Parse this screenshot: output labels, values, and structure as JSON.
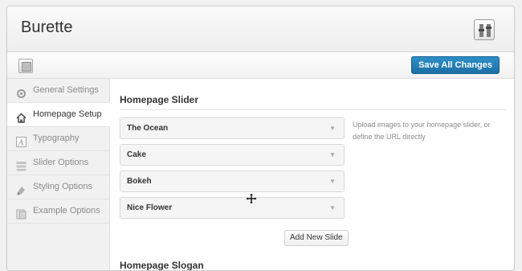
{
  "app": {
    "brand": "Burette",
    "header_icon": "tools-icon"
  },
  "toolbar": {
    "left_icon": "panel-icon",
    "save_label": "Save All Changes",
    "save_color": "#2277b5"
  },
  "sidebar": {
    "items": [
      {
        "label": "General Settings",
        "icon": "gear-icon",
        "active": false
      },
      {
        "label": "Homepage Setup",
        "icon": "home-icon",
        "active": true
      },
      {
        "label": "Typography",
        "icon": "font-icon",
        "active": false
      },
      {
        "label": "Slider Options",
        "icon": "slider-icon",
        "active": false
      },
      {
        "label": "Styling Options",
        "icon": "paint-icon",
        "active": false
      },
      {
        "label": "Example Options",
        "icon": "document-icon",
        "active": false
      }
    ]
  },
  "main": {
    "slider_title": "Homepage Slider",
    "slides": [
      {
        "label": "The Ocean"
      },
      {
        "label": "Cake"
      },
      {
        "label": "Bokeh"
      },
      {
        "label": "Nice Flower"
      }
    ],
    "hint": "Upload images to your homepage slider, or define the URL directly",
    "add_slide_label": "Add New Slide",
    "slogan_title": "Homepage Slogan"
  }
}
